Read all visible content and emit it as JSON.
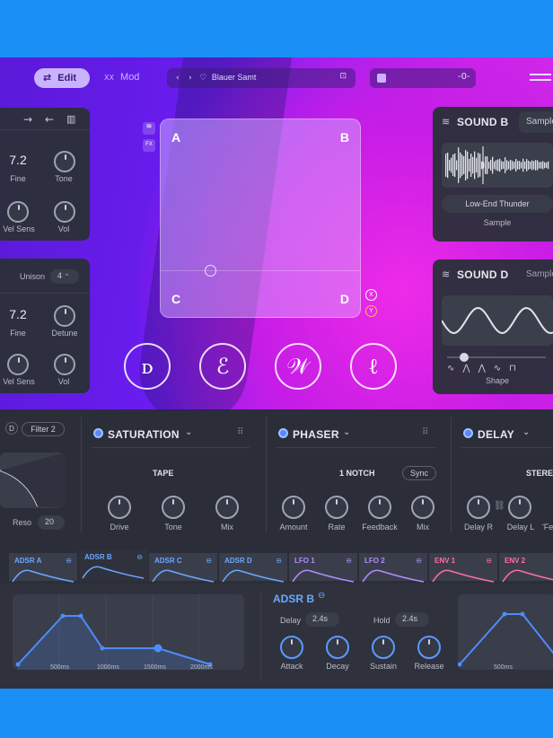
{
  "topbar": {
    "edit_label": "Edit",
    "mod_label": "Mod",
    "preset_name": "Blauer Samt"
  },
  "osc_a": {
    "fine_value": "7.2",
    "fine_label": "Fine",
    "tone_label": "Tone",
    "velsens_label": "Vel Sens",
    "vol_label": "Vol"
  },
  "osc_b": {
    "unison_label": "Unison",
    "unison_value": "4",
    "fine_value": "7.2",
    "fine_label": "Fine",
    "detune_label": "Detune",
    "velsens_label": "Vel Sens",
    "vol_label": "Vol"
  },
  "xy_pad": {
    "corner_a": "A",
    "corner_b": "B",
    "corner_c": "C",
    "corner_d": "D",
    "x_badge": "X",
    "y_badge": "Y",
    "fx_badge": "FX"
  },
  "sound_b": {
    "title": "SOUND B",
    "mode_tab": "Sample",
    "sample_name": "Low-End Thunder",
    "type_label": "Sample"
  },
  "sound_d": {
    "title": "SOUND D",
    "mode_tab": "Sample",
    "shape_label": "Shape"
  },
  "filter": {
    "badge": "D",
    "filter_label": "Filter 2",
    "reso_label": "Reso",
    "reso_value": "20"
  },
  "saturation": {
    "title": "SATURATION",
    "mode": "TAPE",
    "drive": "Drive",
    "tone": "Tone",
    "mix": "Mix"
  },
  "phaser": {
    "title": "PHASER",
    "mode": "1 NOTCH",
    "sync": "Sync",
    "amount": "Amount",
    "rate": "Rate",
    "feedback": "Feedback",
    "mix": "Mix"
  },
  "delay": {
    "title": "DELAY",
    "mode": "STERE",
    "delay_r": "Delay R",
    "delay_l": "Delay L",
    "fb": "'Fe"
  },
  "mod_tabs": [
    {
      "label": "ADSR A",
      "color": "#6aa8ff"
    },
    {
      "label": "ADSR B",
      "color": "#6aa8ff"
    },
    {
      "label": "ADSR C",
      "color": "#6aa8ff"
    },
    {
      "label": "ADSR D",
      "color": "#6aa8ff"
    },
    {
      "label": "LFO 1",
      "color": "#b38cff"
    },
    {
      "label": "LFO 2",
      "color": "#b38cff"
    },
    {
      "label": "ENV 1",
      "color": "#ff6f9e"
    },
    {
      "label": "ENV 2",
      "color": "#ff6f9e"
    }
  ],
  "adsr": {
    "title": "ADSR B",
    "delay_label": "Delay",
    "delay_value": "2.4s",
    "hold_label": "Hold",
    "hold_value": "2.4s",
    "attack": "Attack",
    "decay": "Decay",
    "sustain": "Sustain",
    "release": "Release",
    "ticks": [
      "500ms",
      "1000ms",
      "1500ms",
      "2000ms"
    ],
    "right_tick": "500ms"
  },
  "colors": {
    "accent": "#5a86ff",
    "purple": "#8a2cf0",
    "magenta": "#e22ae6",
    "bg_blue": "#1a8ff5"
  }
}
